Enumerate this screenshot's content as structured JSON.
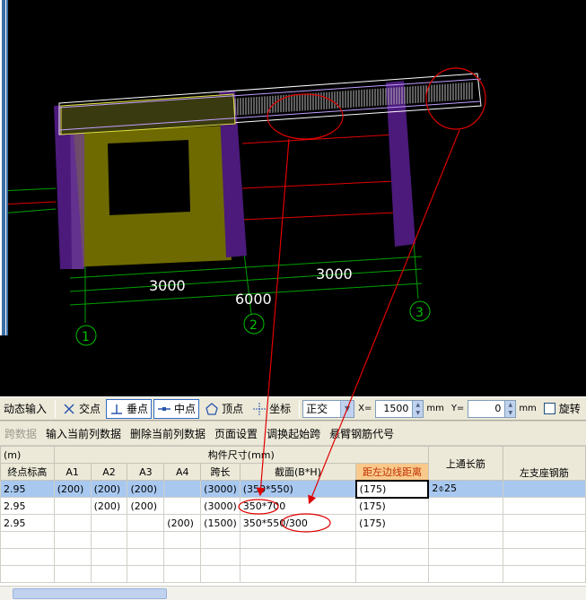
{
  "viewport": {
    "dims": [
      "3000",
      "3000",
      "6000"
    ],
    "axis_labels": [
      "1",
      "2",
      "3"
    ]
  },
  "toolbar": {
    "dynamic_input": "动态输入",
    "intersection": "交点",
    "perpendicular": "垂点",
    "midpoint": "中点",
    "vertex": "顶点",
    "coordinate": "坐标",
    "mode_select": "正交",
    "x_label": "X=",
    "x_value": "1500",
    "x_unit": "mm",
    "y_label": "Y=",
    "y_value": "0",
    "y_unit": "mm",
    "rotate": "旋转",
    "icons": [
      "intersection-icon",
      "perpendicular-icon",
      "midpoint-icon",
      "vertex-icon",
      "coordinate-icon"
    ]
  },
  "menu": {
    "items": [
      "跨数据",
      "输入当前列数据",
      "删除当前列数据",
      "页面设置",
      "调换起始跨",
      "悬臂钢筋代号"
    ]
  },
  "grid": {
    "group_header_left": "(m)",
    "group_header_mid": "构件尺寸(mm)",
    "col_top_bar": "上通长筋",
    "columns": [
      "终点标高",
      "A1",
      "A2",
      "A3",
      "A4",
      "跨长",
      "截面(B*H)",
      "距左边线距离",
      "",
      "左支座钢筋"
    ],
    "rows": [
      [
        "2.95",
        "(200)",
        "(200)",
        "(200)",
        "",
        "(3000)",
        "(350*550)",
        "(175)",
        "2⌽25",
        ""
      ],
      [
        "2.95",
        "",
        "(200)",
        "(200)",
        "",
        "(3000)",
        "350*700",
        "(175)",
        "",
        ""
      ],
      [
        "2.95",
        "",
        "",
        "",
        "(200)",
        "(1500)",
        "350*550/300",
        "(175)",
        "",
        ""
      ]
    ]
  },
  "colors": {
    "beam": "#ffffff",
    "column": "#4b1a7a",
    "wall": "#6e6a00",
    "annotation": "#e00000",
    "axis": "#00c000",
    "highlight_header": "#f9c98c",
    "selected_row": "#a8c8f0"
  }
}
